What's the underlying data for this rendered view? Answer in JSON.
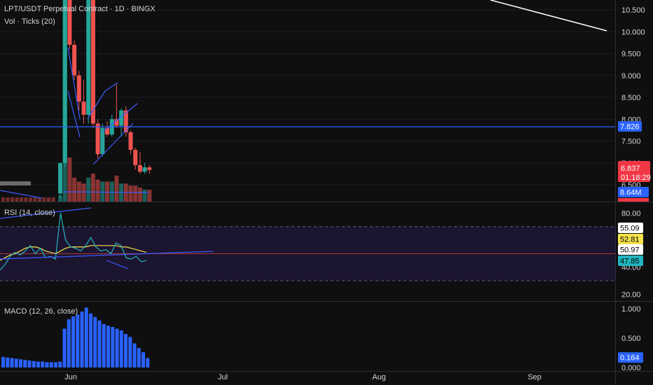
{
  "header": {
    "symbol_line": "LPT/USDT Perpetual Contract · 1D · BINGX",
    "volume_label": "Vol · Ticks (20)"
  },
  "colors": {
    "background": "#0f0f0f",
    "up": "#26a69a",
    "down": "#ef5350",
    "trendline": "#3d5afe",
    "hline": "#2962ff",
    "rsi": "#22b5bf",
    "rsi_ma": "#f6e24b",
    "macd_hist": "#2962ff",
    "price_tag": "#f23645",
    "white_line": "#ffffff"
  },
  "xaxis": {
    "labels": [
      "Jun",
      "Jul",
      "Aug",
      "Sep"
    ]
  },
  "price_pane": {
    "ticks": [
      "10.500",
      "10.000",
      "9.500",
      "9.000",
      "8.500",
      "8.000",
      "7.500",
      "7.000",
      "6.500"
    ],
    "tick_values": [
      10.5,
      10.0,
      9.5,
      9.0,
      8.5,
      8.0,
      7.5,
      7.0,
      6.5
    ],
    "ylim": [
      6.4,
      10.85
    ],
    "hline_value": 7.826,
    "hline_label": "7.826",
    "last_price_label": "6.837",
    "last_price_value": 6.837,
    "countdown_label": "01:18:29",
    "volume_label": "8.64M"
  },
  "rsi_pane": {
    "title": "RSI (14, close)",
    "ticks": [
      "80.00",
      "40.00",
      "20.00"
    ],
    "tick_values": [
      80,
      40,
      20
    ],
    "ylim": [
      15,
      88
    ],
    "upper_band": 70,
    "lower_band": 30,
    "midline": 50,
    "value_labels": [
      "55.09",
      "52.81",
      "50.97",
      "47.85"
    ],
    "value_label_colors": [
      "#ffffff",
      "#f6e24b",
      "#ffffff",
      "#22b5bf"
    ],
    "value_label_values": [
      55.09,
      52.81,
      50.97,
      47.85
    ]
  },
  "macd_pane": {
    "title": "MACD (12, 26, close)",
    "ticks": [
      "1.000",
      "0.500",
      "0.000"
    ],
    "tick_values": [
      1.0,
      0.5,
      0.0
    ],
    "ylim": [
      -0.06,
      1.12
    ],
    "value_label": "0.164",
    "value_label_value": 0.164
  },
  "chart_data": {
    "type": "candlestick",
    "title": "LPT/USDT Perpetual Contract · 1D · BINGX",
    "x_axis_labels": [
      "Jun",
      "Jul",
      "Aug",
      "Sep"
    ],
    "candles": [
      {
        "o": 6.3,
        "h": 7.0,
        "l": 6.2,
        "c": 7.0
      },
      {
        "o": 7.0,
        "h": 10.9,
        "l": 6.9,
        "c": 10.8
      },
      {
        "o": 10.8,
        "h": 10.9,
        "l": 9.6,
        "c": 9.7
      },
      {
        "o": 9.7,
        "h": 9.8,
        "l": 8.9,
        "c": 9.0
      },
      {
        "o": 9.0,
        "h": 9.1,
        "l": 8.2,
        "c": 8.4
      },
      {
        "o": 8.4,
        "h": 8.9,
        "l": 7.9,
        "c": 8.1
      },
      {
        "o": 8.1,
        "h": 10.9,
        "l": 7.9,
        "c": 10.8
      },
      {
        "o": 10.8,
        "h": 10.9,
        "l": 7.8,
        "c": 7.9
      },
      {
        "o": 7.9,
        "h": 8.0,
        "l": 7.1,
        "c": 7.2
      },
      {
        "o": 7.2,
        "h": 7.9,
        "l": 7.15,
        "c": 7.8
      },
      {
        "o": 7.8,
        "h": 7.95,
        "l": 7.6,
        "c": 7.65
      },
      {
        "o": 7.65,
        "h": 8.1,
        "l": 7.6,
        "c": 8.0
      },
      {
        "o": 8.0,
        "h": 8.8,
        "l": 7.8,
        "c": 7.85
      },
      {
        "o": 7.85,
        "h": 8.25,
        "l": 7.6,
        "c": 8.2
      },
      {
        "o": 8.2,
        "h": 8.3,
        "l": 7.6,
        "c": 7.7
      },
      {
        "o": 7.7,
        "h": 7.75,
        "l": 7.2,
        "c": 7.3
      },
      {
        "o": 7.3,
        "h": 7.35,
        "l": 6.85,
        "c": 6.95
      },
      {
        "o": 6.95,
        "h": 7.25,
        "l": 6.75,
        "c": 6.8
      },
      {
        "o": 6.8,
        "h": 7.0,
        "l": 6.75,
        "c": 6.9
      },
      {
        "o": 6.9,
        "h": 6.95,
        "l": 6.75,
        "c": 6.84
      }
    ],
    "volume_relative": [
      0.03,
      1.0,
      0.22,
      0.12,
      0.1,
      0.09,
      0.12,
      0.14,
      0.11,
      0.1,
      0.1,
      0.1,
      0.13,
      0.09,
      0.09,
      0.08,
      0.08,
      0.07,
      0.06,
      0.06
    ],
    "rsi": [
      38,
      42,
      48,
      51,
      49,
      52,
      56,
      50,
      54,
      47,
      48,
      46,
      80,
      60,
      55,
      54,
      52,
      56,
      62,
      55,
      52,
      53,
      50,
      58,
      56,
      47,
      46,
      48,
      44,
      45
    ],
    "rsi_ma": [
      45,
      47,
      49,
      50,
      52,
      54,
      55,
      55,
      54,
      52,
      51,
      50,
      52,
      54,
      55,
      55,
      55,
      55,
      56,
      56,
      56,
      56,
      56,
      56,
      55,
      55,
      54,
      53,
      52,
      51
    ],
    "macd_histogram": [
      0.18,
      0.17,
      0.16,
      0.15,
      0.14,
      0.13,
      0.12,
      0.11,
      0.1,
      0.1,
      0.09,
      0.09,
      0.09,
      0.1,
      0.66,
      0.82,
      0.87,
      0.9,
      0.95,
      1.02,
      0.92,
      0.86,
      0.8,
      0.74,
      0.71,
      0.69,
      0.66,
      0.63,
      0.57,
      0.52,
      0.41,
      0.33,
      0.26,
      0.16
    ]
  }
}
